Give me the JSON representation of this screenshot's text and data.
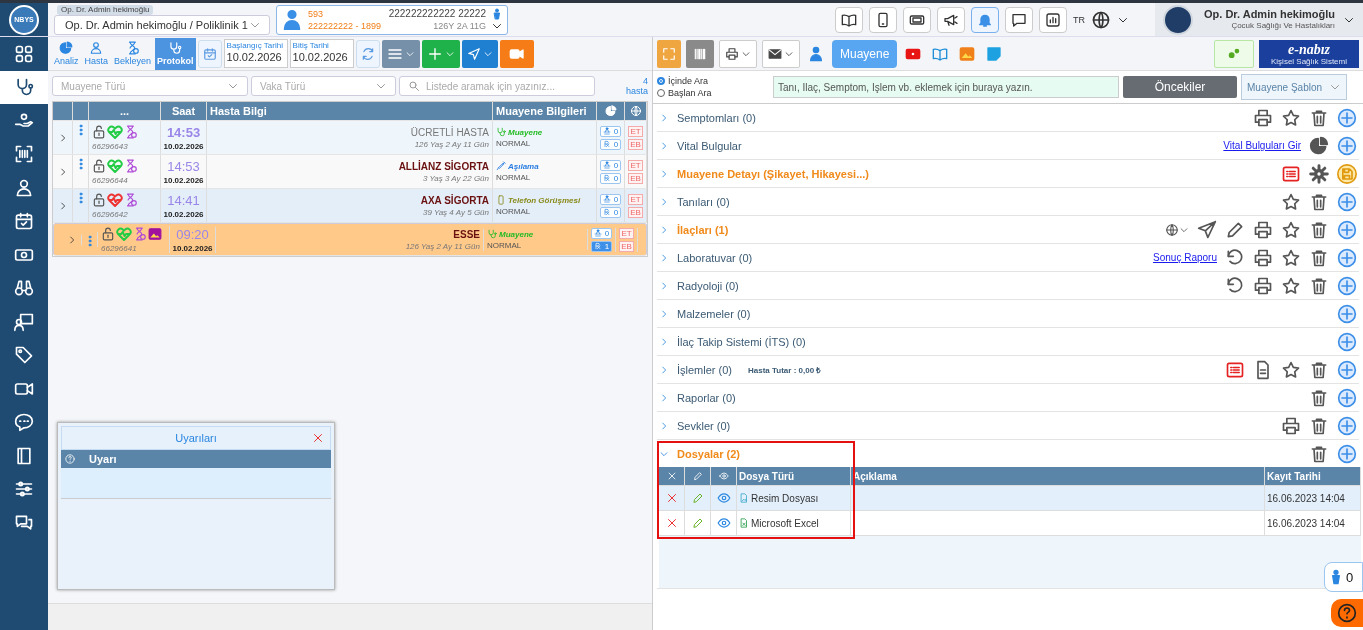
{
  "header": {
    "logo": "NBYS",
    "doctor_select": {
      "label": "Op. Dr. Admin hekimoğlu",
      "value": "Op. Dr. Admin hekimoğlu / Poliklinik 1"
    },
    "patient": {
      "protocol": "593",
      "id_line": "222222222 - 1899",
      "name": "222222222222 22222",
      "age": "126Y 2A 11G"
    },
    "language": "TR",
    "user": {
      "name": "Op. Dr. Admin hekimoğlu",
      "department": "Çocuk Sağlığı Ve Hastalıkları"
    }
  },
  "sidebar": {
    "items": [
      {
        "selected": false
      },
      {
        "selected": true
      },
      {
        "selected": false
      },
      {
        "selected": false
      },
      {
        "selected": false
      },
      {
        "selected": false
      },
      {
        "selected": false
      },
      {
        "selected": false
      },
      {
        "selected": false
      },
      {
        "selected": false
      },
      {
        "selected": false
      },
      {
        "selected": false
      },
      {
        "selected": false
      },
      {
        "selected": false
      },
      {
        "selected": false
      }
    ]
  },
  "left_toolbar": {
    "tabs": [
      {
        "label": "Analiz",
        "selected": false
      },
      {
        "label": "Hasta",
        "selected": false
      },
      {
        "label": "Bekleyen",
        "selected": false
      },
      {
        "label": "Protokol",
        "selected": true
      }
    ],
    "start_date": {
      "label": "Başlangıç Tarihi",
      "value": "10.02.2026"
    },
    "end_date": {
      "label": "Bitiş Tarihi",
      "value": "10.02.2026"
    }
  },
  "filters": {
    "exam_type": {
      "placeholder": "Muayene Türü"
    },
    "case_type": {
      "placeholder": "Vaka Türü"
    },
    "search": {
      "placeholder": "Listede aramak için yazınız..."
    },
    "count": "4",
    "count_label": "hasta"
  },
  "table": {
    "columns": [
      "...",
      "Saat",
      "Hasta Bilgi",
      "Muayene Bilgileri"
    ],
    "rows": [
      {
        "selected": false,
        "color": "#22cc44",
        "has_image": false,
        "id": "66296643",
        "time": "14:53",
        "date": "10.02.2026",
        "insurer": "ÜCRETLİ HASTA",
        "paid": true,
        "age": "126 Yaş 2 Ay 11 Gün",
        "visit": {
          "kind": "exam",
          "label": "Muayene",
          "color": "#22bb22"
        },
        "priority": "NORMAL",
        "count_a": "0",
        "count_b": "0",
        "rx_active": false,
        "tag_1": "ET",
        "tag_2": "EB"
      },
      {
        "selected": false,
        "color": "#22cc44",
        "has_image": false,
        "id": "66296644",
        "time": "14:53",
        "date": "10.02.2026",
        "insurer": "ALLİANZ SİGORTA",
        "paid": false,
        "age": "3 Yaş 3 Ay 22 Gün",
        "visit": {
          "kind": "vaccine",
          "label": "Aşılama",
          "color": "#2a7de1"
        },
        "priority": "NORMAL",
        "count_a": "0",
        "count_b": "0",
        "rx_active": false,
        "tag_1": "ET",
        "tag_2": "EB"
      },
      {
        "selected": false,
        "color": "#ee3333",
        "has_image": false,
        "id": "66296642",
        "time": "14:41",
        "date": "10.02.2026",
        "insurer": "AXA SİGORTA",
        "paid": false,
        "age": "39 Yaş 4 Ay 5 Gün",
        "visit": {
          "kind": "phone",
          "label": "Telefon Görüşmesi",
          "color": "#8a8a1a"
        },
        "priority": "NORMAL",
        "count_a": "0",
        "count_b": "0",
        "rx_active": false,
        "tag_1": "ET",
        "tag_2": "EB"
      },
      {
        "selected": true,
        "color": "#22cc44",
        "has_image": true,
        "id": "66296641",
        "time": "09:20",
        "date": "10.02.2026",
        "insurer": "ESSE",
        "paid": false,
        "age": "126 Yaş 2 Ay 11 Gün",
        "visit": {
          "kind": "exam",
          "label": "Muayene",
          "color": "#22bb22"
        },
        "priority": "NORMAL",
        "count_a": "0",
        "count_b": "1",
        "rx_active": true,
        "tag_1": "ET",
        "tag_2": "EB"
      }
    ]
  },
  "warnings": {
    "title": "Uyarıları",
    "column": "Uyarı"
  },
  "right_toolbar": {
    "exam_button": "Muayene",
    "logo": "e-nabız",
    "logo_sub": "Kişisel Sağlık Sistemi"
  },
  "search": {
    "options": [
      {
        "label": "İçinde Ara",
        "selected": true
      },
      {
        "label": "Başlan Ara",
        "selected": false
      }
    ],
    "input": {
      "placeholder": "Tanı, İlaç, Semptom, İşlem vb. eklemek için buraya yazın."
    },
    "previous_button": "Öncekiler",
    "template_select": {
      "value": "Muayene Şablon"
    }
  },
  "sections": [
    {
      "title": "Semptomları (0)",
      "highlight": false,
      "expanded": false,
      "actions": [
        {
          "kind": "print"
        },
        {
          "kind": "star"
        },
        {
          "kind": "trash"
        },
        {
          "kind": "plus"
        }
      ]
    },
    {
      "title": "Vital Bulgular",
      "highlight": false,
      "expanded": false,
      "link": "Vital Bulguları Gir",
      "actions": [
        {
          "kind": "pie"
        },
        {
          "kind": "plus"
        }
      ]
    },
    {
      "title": "Muayene Detayı (Şikayet, Hikayesi...)",
      "highlight": true,
      "expanded": false,
      "actions": [
        {
          "kind": "list"
        },
        {
          "kind": "gear"
        },
        {
          "kind": "save"
        }
      ]
    },
    {
      "title": "Tanıları (0)",
      "highlight": false,
      "expanded": false,
      "actions": [
        {
          "kind": "star"
        },
        {
          "kind": "trash"
        },
        {
          "kind": "plus"
        }
      ]
    },
    {
      "title": "İlaçları (1)",
      "highlight": true,
      "expanded": false,
      "actions": [
        {
          "kind": "globe"
        },
        {
          "kind": "send"
        },
        {
          "kind": "pencil"
        },
        {
          "kind": "print"
        },
        {
          "kind": "star"
        },
        {
          "kind": "trash"
        },
        {
          "kind": "plus"
        }
      ]
    },
    {
      "title": "Laboratuvar (0)",
      "highlight": false,
      "expanded": false,
      "link": "Sonuç Raporu",
      "actions": [
        {
          "kind": "undo"
        },
        {
          "kind": "print"
        },
        {
          "kind": "star"
        },
        {
          "kind": "trash"
        },
        {
          "kind": "plus"
        }
      ]
    },
    {
      "title": "Radyoloji (0)",
      "highlight": false,
      "expanded": false,
      "actions": [
        {
          "kind": "undo"
        },
        {
          "kind": "print"
        },
        {
          "kind": "star"
        },
        {
          "kind": "trash"
        },
        {
          "kind": "plus"
        }
      ]
    },
    {
      "title": "Malzemeler (0)",
      "highlight": false,
      "expanded": false,
      "actions": [
        {
          "kind": "plus"
        }
      ]
    },
    {
      "title": "İlaç Takip Sistemi (İTS) (0)",
      "highlight": false,
      "expanded": false,
      "actions": [
        {
          "kind": "plus"
        }
      ]
    },
    {
      "title": "İşlemler (0)",
      "highlight": false,
      "expanded": false,
      "note": "Hasta Tutar : 0,00 ₺",
      "actions": [
        {
          "kind": "list"
        },
        {
          "kind": "doc"
        },
        {
          "kind": "star"
        },
        {
          "kind": "trash"
        },
        {
          "kind": "plus"
        }
      ]
    },
    {
      "title": "Raporlar (0)",
      "highlight": false,
      "expanded": false,
      "actions": [
        {
          "kind": "trash"
        },
        {
          "kind": "plus"
        }
      ]
    },
    {
      "title": "Sevkler (0)",
      "highlight": false,
      "expanded": false,
      "actions": [
        {
          "kind": "print"
        },
        {
          "kind": "trash"
        },
        {
          "kind": "plus"
        }
      ]
    },
    {
      "title": "Dosyalar (2)",
      "highlight": true,
      "expanded": true,
      "actions": [
        {
          "kind": "trash"
        },
        {
          "kind": "plus"
        }
      ],
      "files": {
        "columns": [
          "Dosya Türü",
          "Açıklama",
          "Kayıt Tarihi"
        ],
        "rows": [
          {
            "kind": "image",
            "type": "Resim Dosyası",
            "date": "16.06.2023 14:04"
          },
          {
            "kind": "excel",
            "type": "Microsoft Excel",
            "date": "16.06.2023 14:04"
          }
        ]
      }
    }
  ],
  "online": {
    "count": "0"
  }
}
